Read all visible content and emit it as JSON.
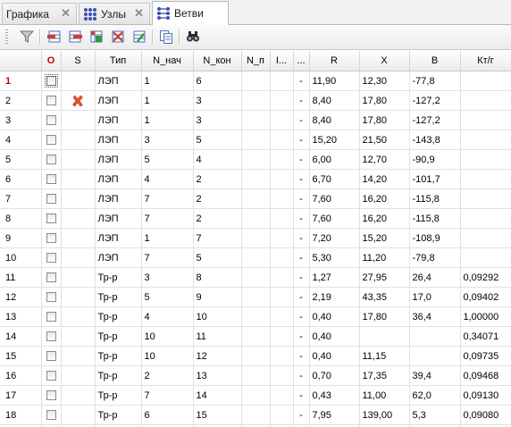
{
  "tabs": [
    {
      "label": "Графика",
      "icon": "graphics-tab-icon",
      "active": false
    },
    {
      "label": "Узлы",
      "icon": "nodes-grid-icon",
      "active": false
    },
    {
      "label": "Ветви",
      "icon": "branches-grid-icon",
      "active": true
    }
  ],
  "toolbar": {
    "items": [
      "filter-icon",
      "add-row-icon",
      "delete-row-icon",
      "insert-row-icon",
      "clear-rows-icon",
      "edit-rows-icon",
      "copy-icon",
      "find-icon"
    ]
  },
  "grid": {
    "columns": [
      "",
      "O",
      "S",
      "Тип",
      "N_нач",
      "N_кон",
      "N_п",
      "I...",
      "...",
      "R",
      "X",
      "B",
      "Кт/г"
    ],
    "rows": [
      {
        "n": "1",
        "s": "",
        "type": "ЛЭП",
        "n_nach": "1",
        "n_kon": "6",
        "dash": "-",
        "r": "11,90",
        "x": "12,30",
        "b": "-77,8",
        "kt": ""
      },
      {
        "n": "2",
        "s": "x",
        "type": "ЛЭП",
        "n_nach": "1",
        "n_kon": "3",
        "dash": "-",
        "r": "8,40",
        "x": "17,80",
        "b": "-127,2",
        "kt": ""
      },
      {
        "n": "3",
        "s": "",
        "type": "ЛЭП",
        "n_nach": "1",
        "n_kon": "3",
        "dash": "-",
        "r": "8,40",
        "x": "17,80",
        "b": "-127,2",
        "kt": ""
      },
      {
        "n": "4",
        "s": "",
        "type": "ЛЭП",
        "n_nach": "3",
        "n_kon": "5",
        "dash": "-",
        "r": "15,20",
        "x": "21,50",
        "b": "-143,8",
        "kt": ""
      },
      {
        "n": "5",
        "s": "",
        "type": "ЛЭП",
        "n_nach": "5",
        "n_kon": "4",
        "dash": "-",
        "r": "6,00",
        "x": "12,70",
        "b": "-90,9",
        "kt": ""
      },
      {
        "n": "6",
        "s": "",
        "type": "ЛЭП",
        "n_nach": "4",
        "n_kon": "2",
        "dash": "-",
        "r": "6,70",
        "x": "14,20",
        "b": "-101,7",
        "kt": ""
      },
      {
        "n": "7",
        "s": "",
        "type": "ЛЭП",
        "n_nach": "7",
        "n_kon": "2",
        "dash": "-",
        "r": "7,60",
        "x": "16,20",
        "b": "-115,8",
        "kt": ""
      },
      {
        "n": "8",
        "s": "",
        "type": "ЛЭП",
        "n_nach": "7",
        "n_kon": "2",
        "dash": "-",
        "r": "7,60",
        "x": "16,20",
        "b": "-115,8",
        "kt": ""
      },
      {
        "n": "9",
        "s": "",
        "type": "ЛЭП",
        "n_nach": "1",
        "n_kon": "7",
        "dash": "-",
        "r": "7,20",
        "x": "15,20",
        "b": "-108,9",
        "kt": ""
      },
      {
        "n": "10",
        "s": "",
        "type": "ЛЭП",
        "n_nach": "7",
        "n_kon": "5",
        "dash": "-",
        "r": "5,30",
        "x": "11,20",
        "b": "-79,8",
        "kt": ""
      },
      {
        "n": "11",
        "s": "",
        "type": "Тр-р",
        "n_nach": "3",
        "n_kon": "8",
        "dash": "-",
        "r": "1,27",
        "x": "27,95",
        "b": "26,4",
        "kt": "0,09292"
      },
      {
        "n": "12",
        "s": "",
        "type": "Тр-р",
        "n_nach": "5",
        "n_kon": "9",
        "dash": "-",
        "r": "2,19",
        "x": "43,35",
        "b": "17,0",
        "kt": "0,09402"
      },
      {
        "n": "13",
        "s": "",
        "type": "Тр-р",
        "n_nach": "4",
        "n_kon": "10",
        "dash": "-",
        "r": "0,40",
        "x": "17,80",
        "b": "36,4",
        "kt": "1,00000"
      },
      {
        "n": "14",
        "s": "",
        "type": "Тр-р",
        "n_nach": "10",
        "n_kon": "11",
        "dash": "-",
        "r": "0,40",
        "x": "",
        "b": "",
        "kt": "0,34071"
      },
      {
        "n": "15",
        "s": "",
        "type": "Тр-р",
        "n_nach": "10",
        "n_kon": "12",
        "dash": "-",
        "r": "0,40",
        "x": "11,15",
        "b": "",
        "kt": "0,09735"
      },
      {
        "n": "16",
        "s": "",
        "type": "Тр-р",
        "n_nach": "2",
        "n_kon": "13",
        "dash": "-",
        "r": "0,70",
        "x": "17,35",
        "b": "39,4",
        "kt": "0,09468"
      },
      {
        "n": "17",
        "s": "",
        "type": "Тр-р",
        "n_nach": "7",
        "n_kon": "14",
        "dash": "-",
        "r": "0,43",
        "x": "11,00",
        "b": "62,0",
        "kt": "0,09130"
      },
      {
        "n": "18",
        "s": "",
        "type": "Тр-р",
        "n_nach": "6",
        "n_kon": "15",
        "dash": "-",
        "r": "7,95",
        "x": "139,00",
        "b": "5,3",
        "kt": "0,09080"
      }
    ]
  },
  "colors": {
    "first_row_number": "#d00000",
    "delete_mark": "#e8552a",
    "new_row_marker": "#5c86d6"
  }
}
